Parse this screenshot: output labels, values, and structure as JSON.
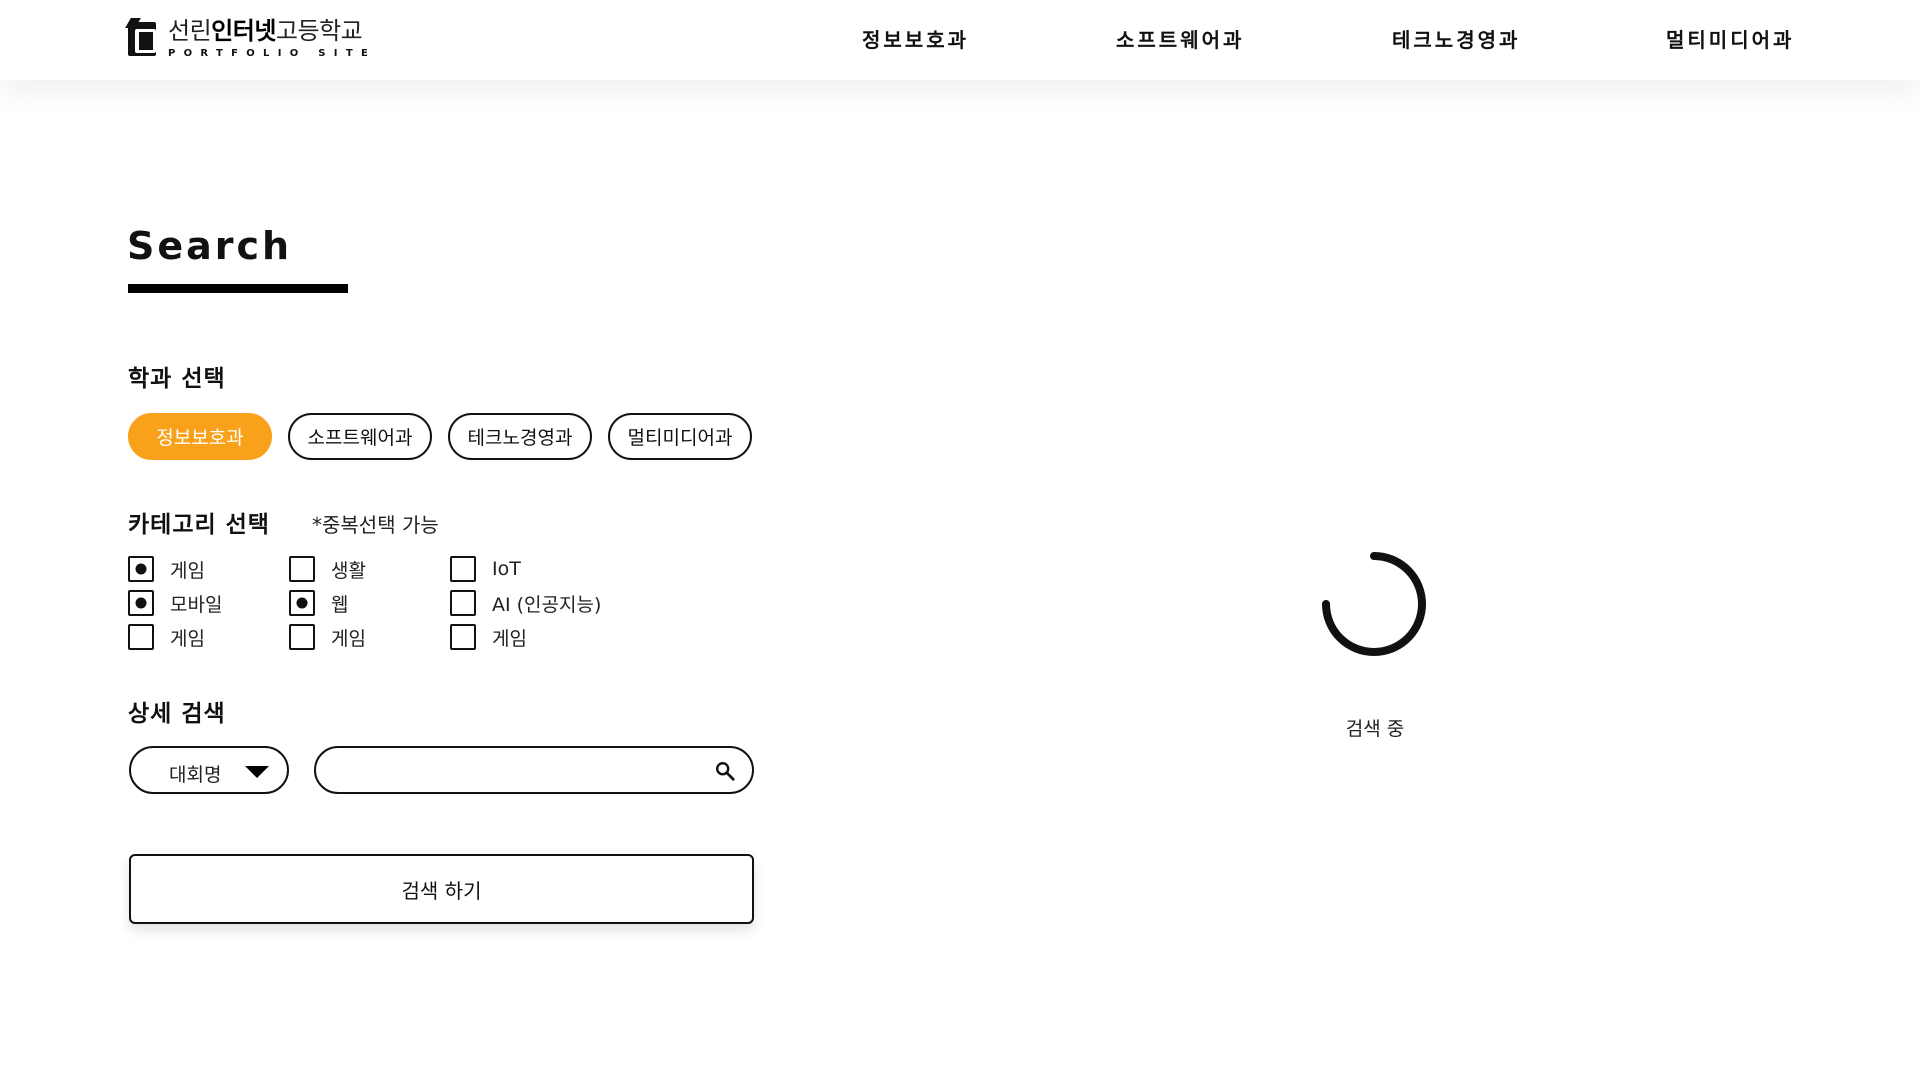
{
  "header": {
    "logo": {
      "title_light_1": "선린",
      "title_bold": "인터넷",
      "title_light_2": "고등학교",
      "subtitle": "PORTFOLIO SITE"
    },
    "nav": [
      {
        "label": "정보보호과"
      },
      {
        "label": "소프트웨어과"
      },
      {
        "label": "테크노경영과"
      },
      {
        "label": "멀티미디어과"
      }
    ]
  },
  "search": {
    "title": "Search"
  },
  "department": {
    "label": "학과 선택",
    "options": [
      {
        "label": "정보보호과",
        "active": true
      },
      {
        "label": "소프트웨어과",
        "active": false
      },
      {
        "label": "테크노경영과",
        "active": false
      },
      {
        "label": "멀티미디어과",
        "active": false
      }
    ],
    "accent_color": "#f9a11b"
  },
  "category": {
    "label": "카테고리 선택",
    "note": "*중복선택 가능",
    "items": [
      {
        "label": "게임",
        "checked": true
      },
      {
        "label": "모바일",
        "checked": true
      },
      {
        "label": "게임",
        "checked": false
      },
      {
        "label": "생활",
        "checked": false
      },
      {
        "label": "웹",
        "checked": true
      },
      {
        "label": "게임",
        "checked": false
      },
      {
        "label": "IoT",
        "checked": false
      },
      {
        "label": "AI (인공지능)",
        "checked": false
      },
      {
        "label": "게임",
        "checked": false
      }
    ]
  },
  "detail": {
    "label": "상세 검색",
    "select_value": "대회명",
    "input_value": "",
    "input_placeholder": ""
  },
  "submit": {
    "label": "검색 하기"
  },
  "loading": {
    "text": "검색 중"
  }
}
